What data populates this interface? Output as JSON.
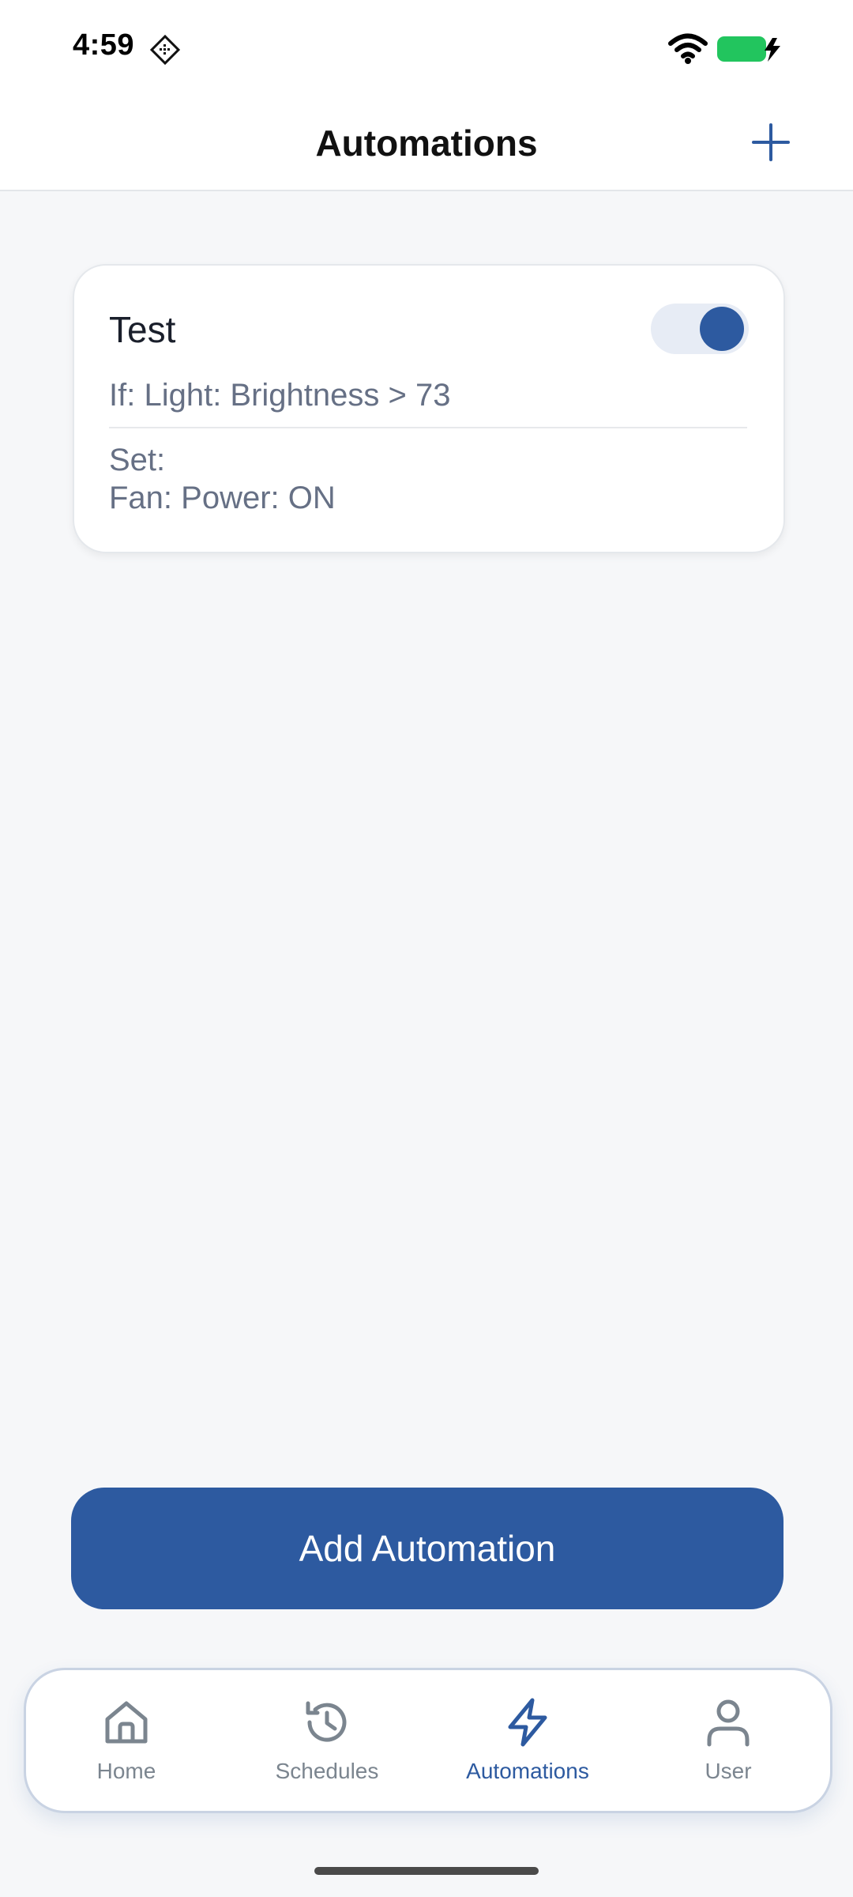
{
  "status_bar": {
    "time": "4:59"
  },
  "header": {
    "title": "Automations"
  },
  "automations": [
    {
      "name": "Test",
      "enabled": true,
      "condition": "If: Light: Brightness > 73",
      "set_label": "Set:",
      "action": "Fan: Power: ON"
    }
  ],
  "add_button_label": "Add Automation",
  "bottom_nav": {
    "items": [
      {
        "label": "Home",
        "icon": "home-icon",
        "active": false
      },
      {
        "label": "Schedules",
        "icon": "history-icon",
        "active": false
      },
      {
        "label": "Automations",
        "icon": "lightning-icon",
        "active": true
      },
      {
        "label": "User",
        "icon": "user-icon",
        "active": false
      }
    ]
  },
  "colors": {
    "accent": "#2d5aa0",
    "background": "#f6f7f9",
    "muted_text": "#667085",
    "nav_inactive": "#7b858f",
    "battery": "#22c55e"
  }
}
